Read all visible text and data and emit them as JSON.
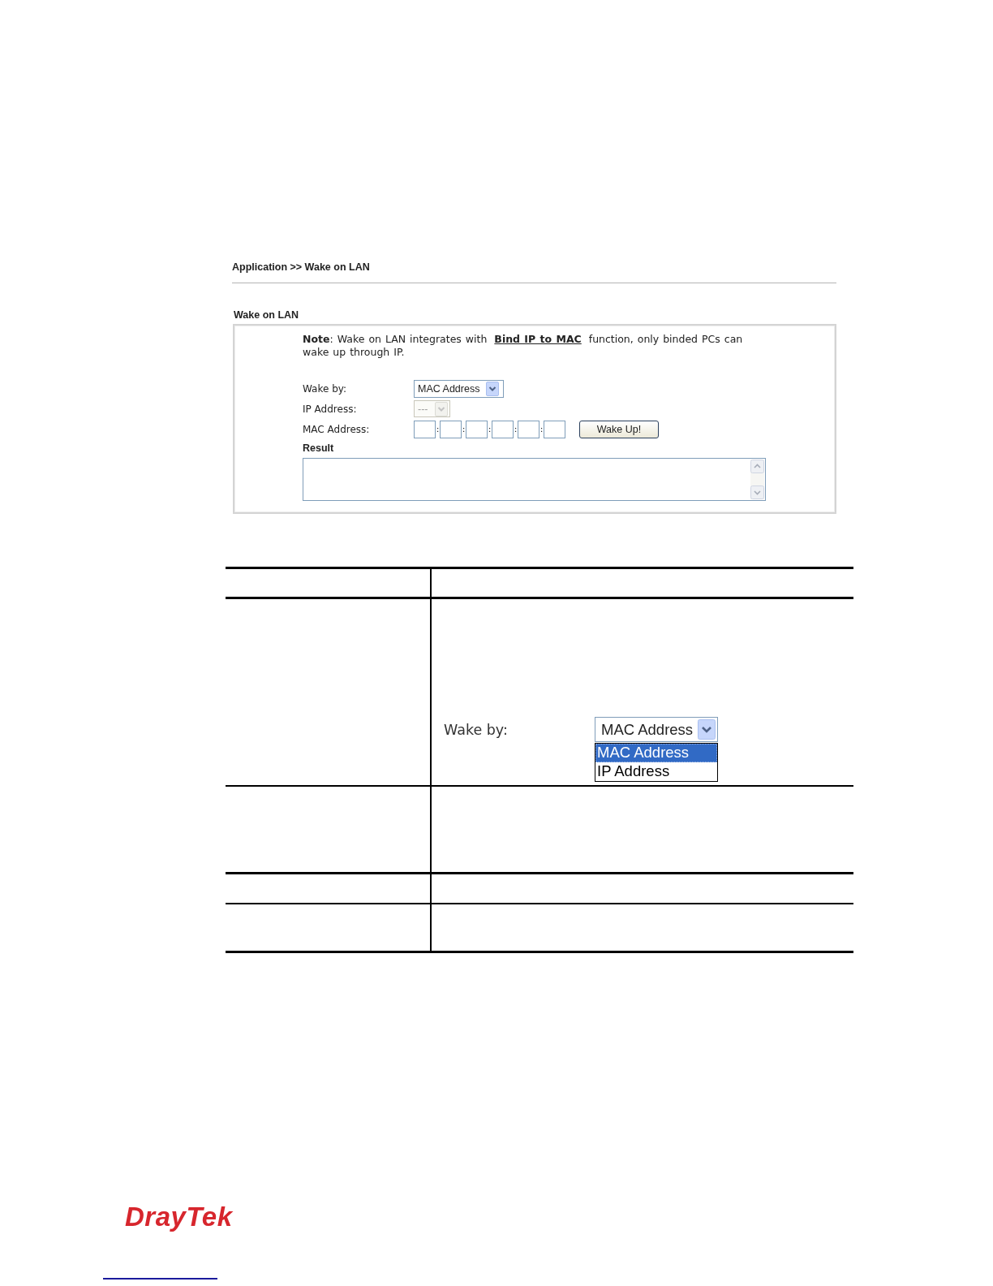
{
  "breadcrumb": "Application >> Wake on LAN",
  "panel": {
    "title": "Wake on LAN",
    "note": {
      "lead": "**Note**: Wake on LAN integrates with",
      "link": "Bind IP to MAC",
      "tail": "function, only binded PCs can wake up through IP."
    },
    "fields": [
      {
        "kind": "select",
        "label": "Wake by:",
        "value": "MAC Address",
        "disabled": false
      },
      {
        "kind": "select",
        "label": "IP Address:",
        "value": "---",
        "disabled": true
      },
      {
        "kind": "mac",
        "label": "MAC Address:",
        "separators": [
          ":",
          ":",
          ":",
          ":",
          ":"
        ],
        "button": "Wake Up!"
      }
    ],
    "result": {
      "label": "Result"
    }
  },
  "table": {
    "rows": [
      {
        "kind": "header"
      },
      {
        "kind": "inset",
        "inset": {
          "label": "Wake by:",
          "value": "MAC Address",
          "options": [
            {
              "label": "MAC Address",
              "selected": true
            },
            {
              "label": "IP Address",
              "selected": false
            }
          ]
        }
      },
      {
        "kind": "blank"
      },
      {
        "kind": "blank"
      },
      {
        "kind": "blank"
      }
    ]
  },
  "footer": {
    "logo": "DrayTek"
  }
}
